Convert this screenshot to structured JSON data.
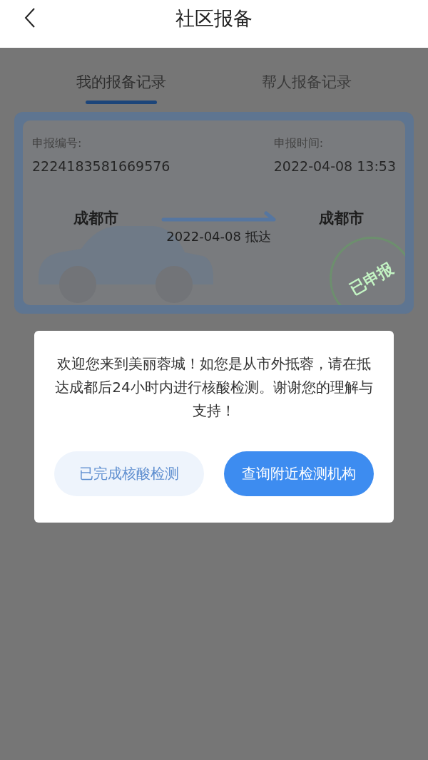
{
  "header": {
    "title": "社区报备"
  },
  "tabs": [
    {
      "label": "我的报备记录",
      "selected": true
    },
    {
      "label": "帮人报备记录",
      "selected": false
    }
  ],
  "record": {
    "number_label": "申报编号:",
    "number": "2224183581669576",
    "time_label": "申报时间:",
    "time": "2022-04-08 13:53",
    "from": "成都市",
    "to": "成都市",
    "arrival": "2022-04-08 抵达",
    "stamp": "已申报"
  },
  "dialog": {
    "message": "欢迎您来到美丽蓉城！如您是从市外抵蓉，请在抵达成都后24小时内进行核酸检测。谢谢您的理解与支持！",
    "buttons": [
      {
        "label": "已完成核酸检测",
        "kind": "secondary"
      },
      {
        "label": "查询附近检测机构",
        "kind": "primary"
      }
    ]
  }
}
